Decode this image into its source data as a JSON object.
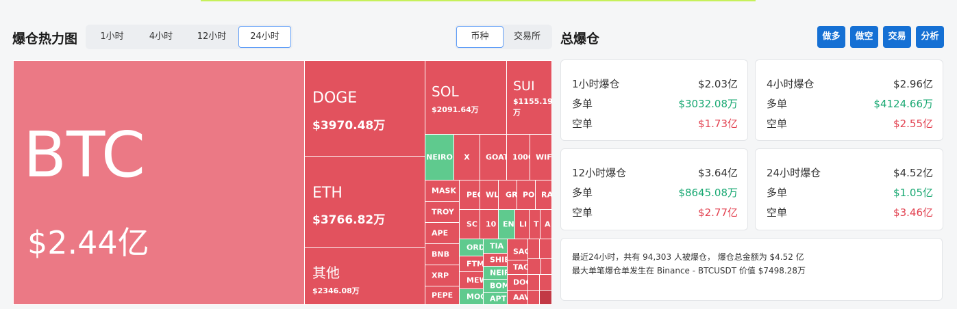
{
  "heatmap": {
    "title": "爆仓热力图",
    "time_options": [
      "1小时",
      "4小时",
      "12小时",
      "24小时"
    ],
    "time_selected": "24小时",
    "mode_options": [
      "币种",
      "交易所"
    ],
    "mode_selected": "币种",
    "cells": [
      {
        "sym": "BTC",
        "amt": "$2.44亿",
        "color": "light-red"
      },
      {
        "sym": "DOGE",
        "amt": "$3970.48万",
        "color": "red"
      },
      {
        "sym": "ETH",
        "amt": "$3766.82万",
        "color": "red"
      },
      {
        "sym": "其他",
        "amt": "$2346.08万",
        "color": "red"
      },
      {
        "sym": "SOL",
        "amt": "$2091.64万",
        "color": "red"
      },
      {
        "sym": "SUI",
        "amt": "$1155.19 万",
        "color": "red"
      },
      {
        "sym": "NEIRO",
        "color": "green"
      },
      {
        "sym": "X",
        "color": "red"
      },
      {
        "sym": "GOAT",
        "color": "red"
      },
      {
        "sym": "1000",
        "color": "red"
      },
      {
        "sym": "WIF",
        "color": "red"
      },
      {
        "sym": "MASK",
        "color": "red"
      },
      {
        "sym": "TROY",
        "color": "red"
      },
      {
        "sym": "APE",
        "color": "red"
      },
      {
        "sym": "BNB",
        "color": "red"
      },
      {
        "sym": "XRP",
        "color": "red"
      },
      {
        "sym": "PEPE",
        "color": "red"
      },
      {
        "sym": "PEO",
        "color": "red"
      },
      {
        "sym": "WL",
        "color": "red"
      },
      {
        "sym": "GR",
        "color": "red"
      },
      {
        "sym": "PO",
        "color": "red"
      },
      {
        "sym": "RA",
        "color": "red"
      },
      {
        "sym": "SC",
        "color": "red"
      },
      {
        "sym": "10",
        "color": "red"
      },
      {
        "sym": "EN",
        "color": "green"
      },
      {
        "sym": "LI",
        "color": "red"
      },
      {
        "sym": "T",
        "color": "red"
      },
      {
        "sym": "A",
        "color": "red"
      },
      {
        "sym": "ORD",
        "color": "green"
      },
      {
        "sym": "TIA",
        "color": "green"
      },
      {
        "sym": "FTM",
        "color": "red"
      },
      {
        "sym": "SHIB",
        "color": "red"
      },
      {
        "sym": "MEW",
        "color": "red"
      },
      {
        "sym": "NEIR",
        "color": "green"
      },
      {
        "sym": "MOO",
        "color": "green"
      },
      {
        "sym": "BOM",
        "color": "green"
      },
      {
        "sym": "APT",
        "color": "green"
      },
      {
        "sym": "SAG",
        "color": "red"
      },
      {
        "sym": "TAC",
        "color": "red"
      },
      {
        "sym": "DOG",
        "color": "red"
      },
      {
        "sym": "AAV",
        "color": "red"
      }
    ]
  },
  "total": {
    "title": "总爆仓",
    "actions": [
      "做多",
      "做空",
      "交易",
      "分析"
    ],
    "cards": [
      {
        "label": "1小时爆仓",
        "total": "$2.03亿",
        "long_label": "多单",
        "long": "$3032.08万",
        "short_label": "空单",
        "short": "$1.73亿"
      },
      {
        "label": "4小时爆仓",
        "total": "$2.96亿",
        "long_label": "多单",
        "long": "$4124.66万",
        "short_label": "空单",
        "short": "$2.55亿"
      },
      {
        "label": "12小时爆仓",
        "total": "$3.64亿",
        "long_label": "多单",
        "long": "$8645.08万",
        "short_label": "空单",
        "short": "$2.77亿"
      },
      {
        "label": "24小时爆仓",
        "total": "$4.52亿",
        "long_label": "多单",
        "long": "$1.05亿",
        "short_label": "空单",
        "short": "$3.46亿"
      }
    ],
    "summary_line1": "最近24小时，共有 94,303 人被爆仓， 爆仓总金额为 $4.52 亿",
    "summary_line2": "最大单笔爆仓单发生在 Binance - BTCUSDT 价值 $7498.28万"
  },
  "colors": {
    "red": "#e2525e",
    "light_red": "#eb7985",
    "green": "#5fca8e",
    "accent_blue": "#1570d4",
    "long_green": "#18a872",
    "short_red": "#e2404f"
  }
}
